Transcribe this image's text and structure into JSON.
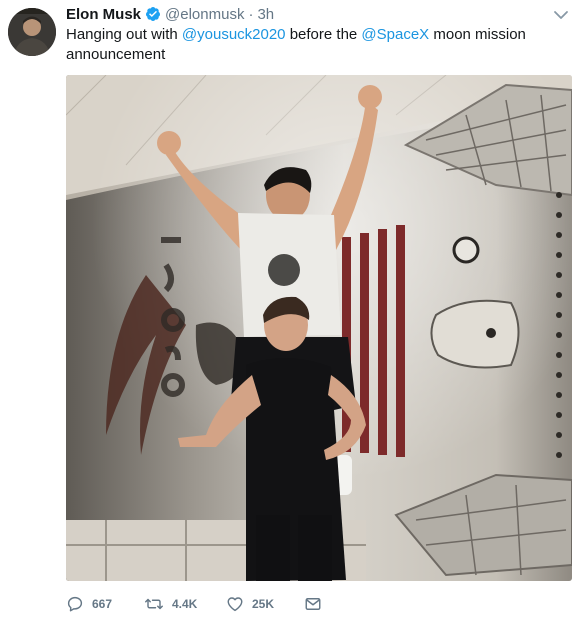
{
  "tweet": {
    "display_name": "Elon Musk",
    "handle": "@elonmusk",
    "separator": "·",
    "time": "3h",
    "text_segments": [
      "Hanging out with ",
      "@yousuck2020",
      " before the ",
      "@SpaceX",
      " moon mission announcement"
    ],
    "actions": {
      "reply_count": "667",
      "retweet_count": "4.4K",
      "like_count": "25K"
    },
    "icons": {
      "verified": "verified-badge-icon",
      "caret": "chevron-down-icon",
      "reply": "reply-icon",
      "retweet": "retweet-icon",
      "like": "heart-icon",
      "dm": "envelope-icon"
    },
    "colors": {
      "link": "#1b95e0",
      "muted": "#657786",
      "text": "#14171a",
      "verified": "#1da1f2"
    }
  }
}
